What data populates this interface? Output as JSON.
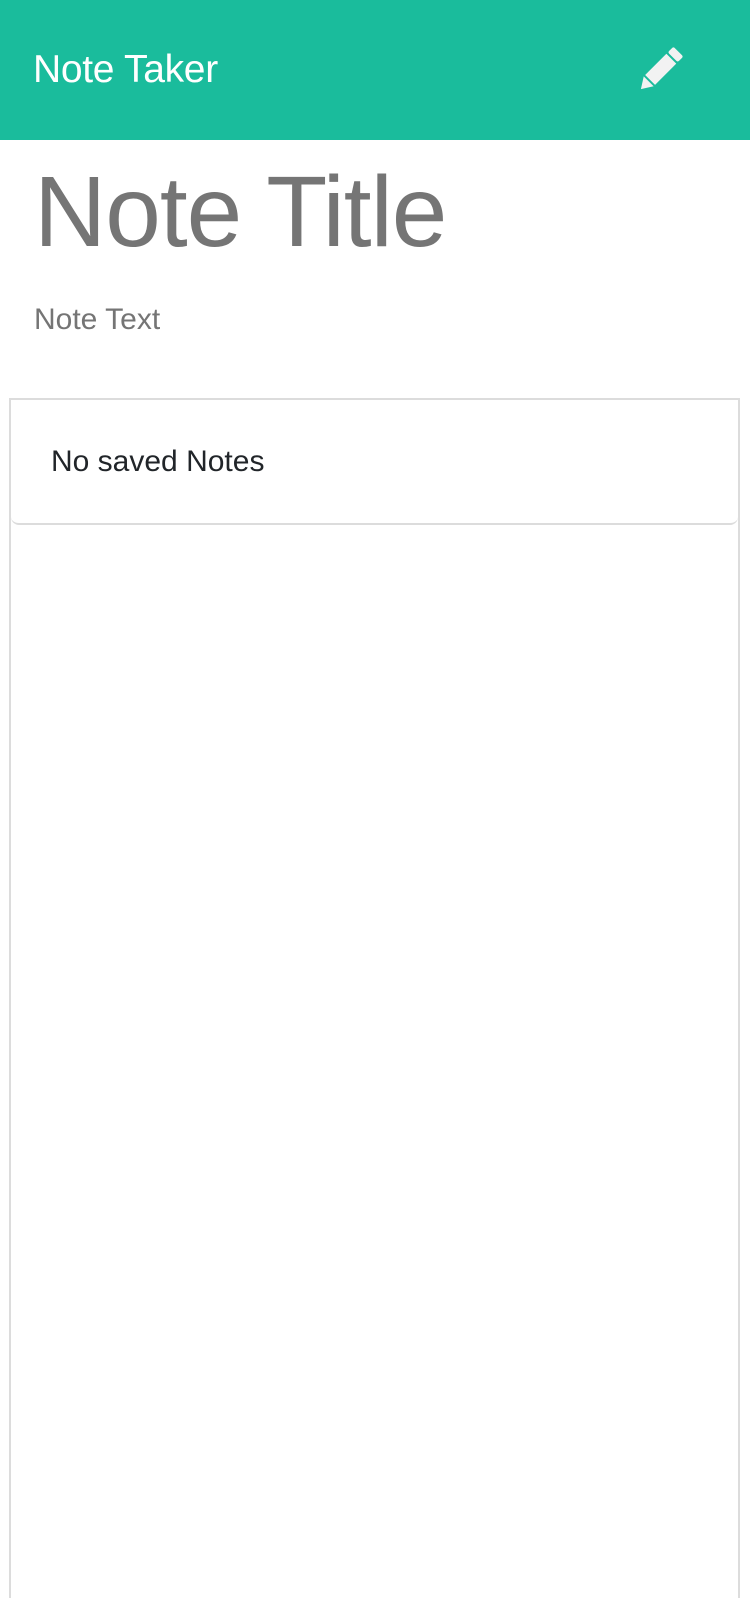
{
  "navbar": {
    "brand": "Note Taker",
    "write_icon": "pencil-icon",
    "background_color": "#1abc9c"
  },
  "editor": {
    "title_placeholder": "Note Title",
    "text_placeholder": "Note Text"
  },
  "notes_list": {
    "empty_message": "No saved Notes"
  }
}
